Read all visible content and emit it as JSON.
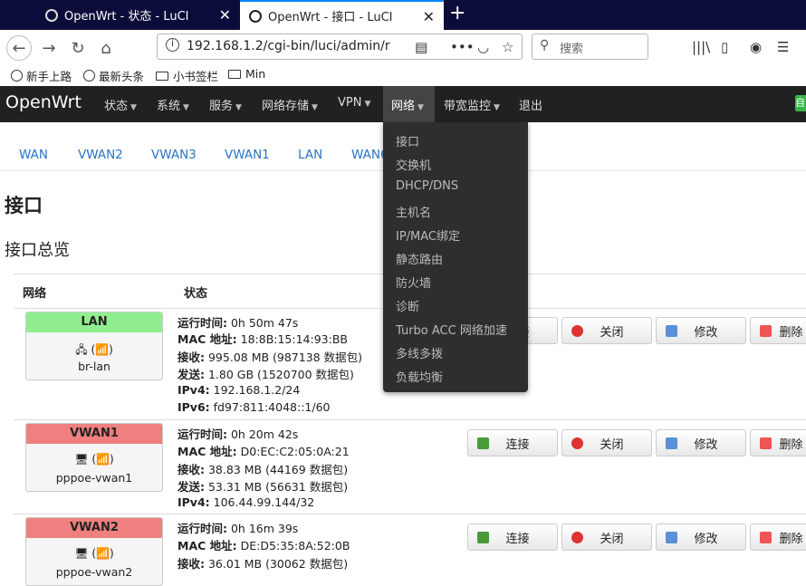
{
  "browser": {
    "tabs": [
      {
        "title": "OpenWrt - 状态 - LuCI"
      },
      {
        "title": "OpenWrt - 接口 - LuCI"
      }
    ],
    "url": "192.168.1.2/cgi-bin/luci/admin/r",
    "search_placeholder": "搜索",
    "bookmarks": [
      "新手上路",
      "最新头条",
      "小书签栏",
      "Min"
    ]
  },
  "luci": {
    "brand": "OpenWrt",
    "menu": [
      "状态",
      "系统",
      "服务",
      "网络存储",
      "VPN",
      "网络",
      "带宽监控",
      "退出"
    ],
    "badge": "自",
    "dropdown": [
      "接口",
      "交换机",
      "DHCP/DNS",
      "主机名",
      "IP/MAC绑定",
      "静态路由",
      "防火墙",
      "诊断",
      "Turbo ACC 网络加速",
      "多线多拨",
      "负载均衡"
    ]
  },
  "iface_tabs": [
    "WAN",
    "VWAN2",
    "VWAN3",
    "VWAN1",
    "LAN",
    "WAN6"
  ],
  "page": {
    "title": "接口",
    "subtitle": "接口总览",
    "col_network": "网络",
    "col_status": "状态"
  },
  "labels": {
    "uptime": "运行时间:",
    "mac": "MAC 地址:",
    "rx": "接收:",
    "tx": "发送:",
    "ipv4": "IPv4:",
    "ipv6": "IPv6:"
  },
  "buttons": {
    "connect": "连接",
    "stop": "关闭",
    "edit": "修改",
    "delete": "删除"
  },
  "colors": {
    "lan": "#90ee90",
    "wan": "#f08080",
    "menu_bg": "#212121",
    "link": "#2a73c6"
  },
  "interfaces": [
    {
      "name": "LAN",
      "device": "br-lan",
      "uptime": "0h 50m 47s",
      "mac": "18:8B:15:14:93:BB",
      "rx": "995.08 MB (987138 数据包)",
      "tx": "1.80 GB (1520700 数据包)",
      "ipv4": "192.168.1.2/24",
      "ipv6": "fd97:811:4048::1/60"
    },
    {
      "name": "VWAN1",
      "device": "pppoe-vwan1",
      "uptime": "0h 20m 42s",
      "mac": "D0:EC:C2:05:0A:21",
      "rx": "38.83 MB (44169 数据包)",
      "tx": "53.31 MB (56631 数据包)",
      "ipv4": "106.44.99.144/32"
    },
    {
      "name": "VWAN2",
      "device": "pppoe-vwan2",
      "uptime": "0h 16m 39s",
      "mac": "DE:D5:35:8A:52:0B",
      "rx": "36.01 MB (30062 数据包)"
    }
  ]
}
